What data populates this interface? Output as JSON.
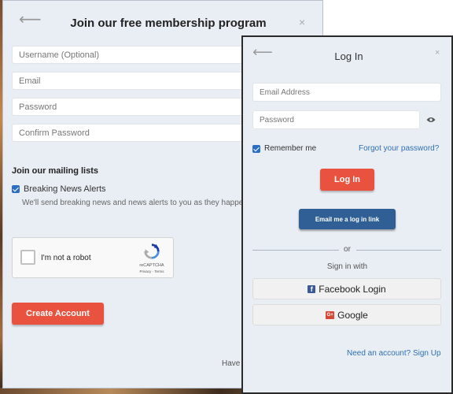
{
  "signup": {
    "back": "⟵",
    "close": "×",
    "title": "Join our free membership program",
    "fields": {
      "username_placeholder": "Username (Optional)",
      "email_placeholder": "Email",
      "password_placeholder": "Password",
      "confirm_placeholder": "Confirm Password"
    },
    "mailing_heading": "Join our mailing lists",
    "breaking_news_label": "Breaking News Alerts",
    "breaking_news_checked": true,
    "breaking_news_note": "We'll send breaking news and news alerts to you as they happen",
    "captcha": {
      "label": "I'm not a robot",
      "brand": "reCAPTCHA",
      "terms": "Privacy - Terms"
    },
    "create_button": "Create Account",
    "have_account": "Have a"
  },
  "login": {
    "back": "⟵",
    "close": "×",
    "title": "Log In",
    "email_placeholder": "Email Address",
    "password_placeholder": "Password",
    "remember_label": "Remember me",
    "remember_checked": true,
    "forgot_link": "Forgot your password?",
    "login_button": "Log In",
    "email_link_button": "Email me a log in link",
    "or": "or",
    "sign_in_with": "Sign in with",
    "facebook_button": "Facebook Login",
    "facebook_icon_glyph": "f",
    "google_button": "Google",
    "google_icon_glyph": "G+",
    "need_account": "Need an account? Sign Up"
  },
  "colors": {
    "accent_red": "#e8523f",
    "link_blue": "#2f6fb3",
    "email_button_blue": "#2f5f94",
    "panel_bg": "#e9eef4"
  }
}
